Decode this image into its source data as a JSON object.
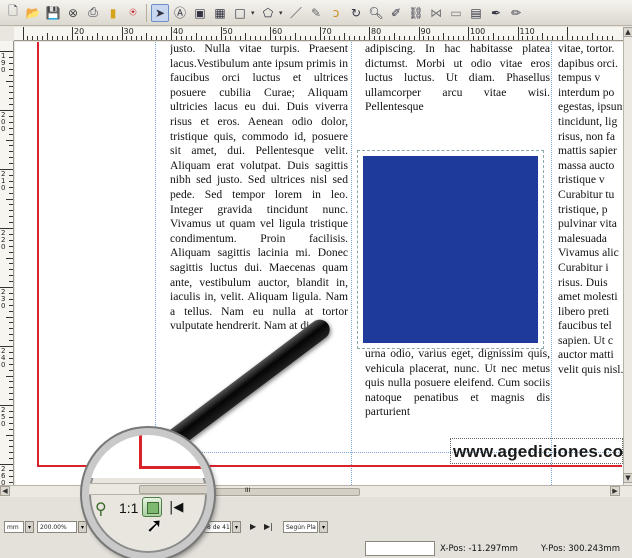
{
  "toolbar": {
    "icons": [
      "new-document-icon",
      "open-folder-icon",
      "save-icon",
      "close-icon",
      "print-icon",
      "preflight-icon",
      "pdf-icon",
      "select-tool-icon",
      "text-frame-icon",
      "image-frame-icon",
      "table-icon",
      "shape-icon",
      "polygon-icon",
      "line-icon",
      "bezier-icon",
      "freehand-icon",
      "rotate-icon",
      "zoom-icon",
      "edit-contents-icon",
      "link-text-icon",
      "unlink-text-icon",
      "measure-icon",
      "copy-properties-icon",
      "eyedropper-icon"
    ]
  },
  "ruler": {
    "h_labels": [
      "20",
      "30",
      "40",
      "50",
      "60",
      "70",
      "80",
      "90",
      "100",
      "110"
    ],
    "v_labels": [
      "1\n9\n0",
      "2\n0\n0",
      "2\n1\n0",
      "2\n2\n0",
      "2\n3\n0",
      "2\n4\n0",
      "2\n5\n0",
      "2\n6\n0"
    ]
  },
  "document": {
    "col1_text": "justo. Nulla vitae turpis. Praesent lacus.Vestibulum ante ipsum primis in faucibus orci luctus et ultrices posuere cubilia Curae; Aliquam ultricies lacus eu dui. Duis viverra risus et eros. Aenean odio dolor, tristique quis, commodo id, posuere sit amet, dui. Pellentesque velit. Aliquam erat volutpat. Duis sagittis nibh sed justo. Sed ultrices nisl sed pede. Sed tempor lorem in leo. Integer gravida tincidunt nunc. Vivamus ut quam vel ligula tristique condimentum. Proin facilisis. Aliquam sagittis lacinia mi. Donec sagittis luctus dui. Maecenas quam ante, vestibulum auctor, blandit in, iaculis in, velit. Aliquam ligula. Nam a tellus. Nam eu nulla at tortor vulputate hendrerit. Nam at diam.",
    "col2_text": "adipiscing. In hac habitasse platea dictumst. Morbi ut odio vitae eros luctus luctus. Ut diam. Phasellus ullamcorper arcu vitae wisi. Pellentesque",
    "col2b_text": "urna odio, varius eget, dignissim quis, vehicula placerat, nunc. Ut nec metus quis nulla posuere eleifend. Cum sociis natoque penatibus et magnis dis parturient",
    "col3_lines": [
      "vitae, tortor.",
      "dapibus orci.",
      "tempus v",
      "interdum po",
      "egestas, ipsun",
      "tincidunt, lig",
      "risus, non fa",
      "mattis sapier",
      "massa aucto",
      "tristique v",
      "Curabitur tu",
      "tristique, p",
      "pulvinar vita",
      "malesuada",
      "Vivamus alic",
      "Curabitur i",
      "risus. Duis",
      "amet molesti",
      "libero preti",
      "faucibus tel",
      "sapien. Ut c",
      "auctor matti",
      "velit quis nisl."
    ],
    "website": "www.agediciones.co"
  },
  "statusbar": {
    "unit": "mm",
    "zoom": "200.00%",
    "page_of": "8 de 41",
    "layer": "Según Pla",
    "x_pos": "X-Pos: -11.297mm",
    "y_pos": "Y-Pos: 300.243mm",
    "hscroll_label": "III"
  },
  "magnifier": {
    "ratio_label": "1:1",
    "first_page_icon": "first-page-icon",
    "zoom_icon": "zoom-icon",
    "fit_icon": "fit-page-icon"
  }
}
